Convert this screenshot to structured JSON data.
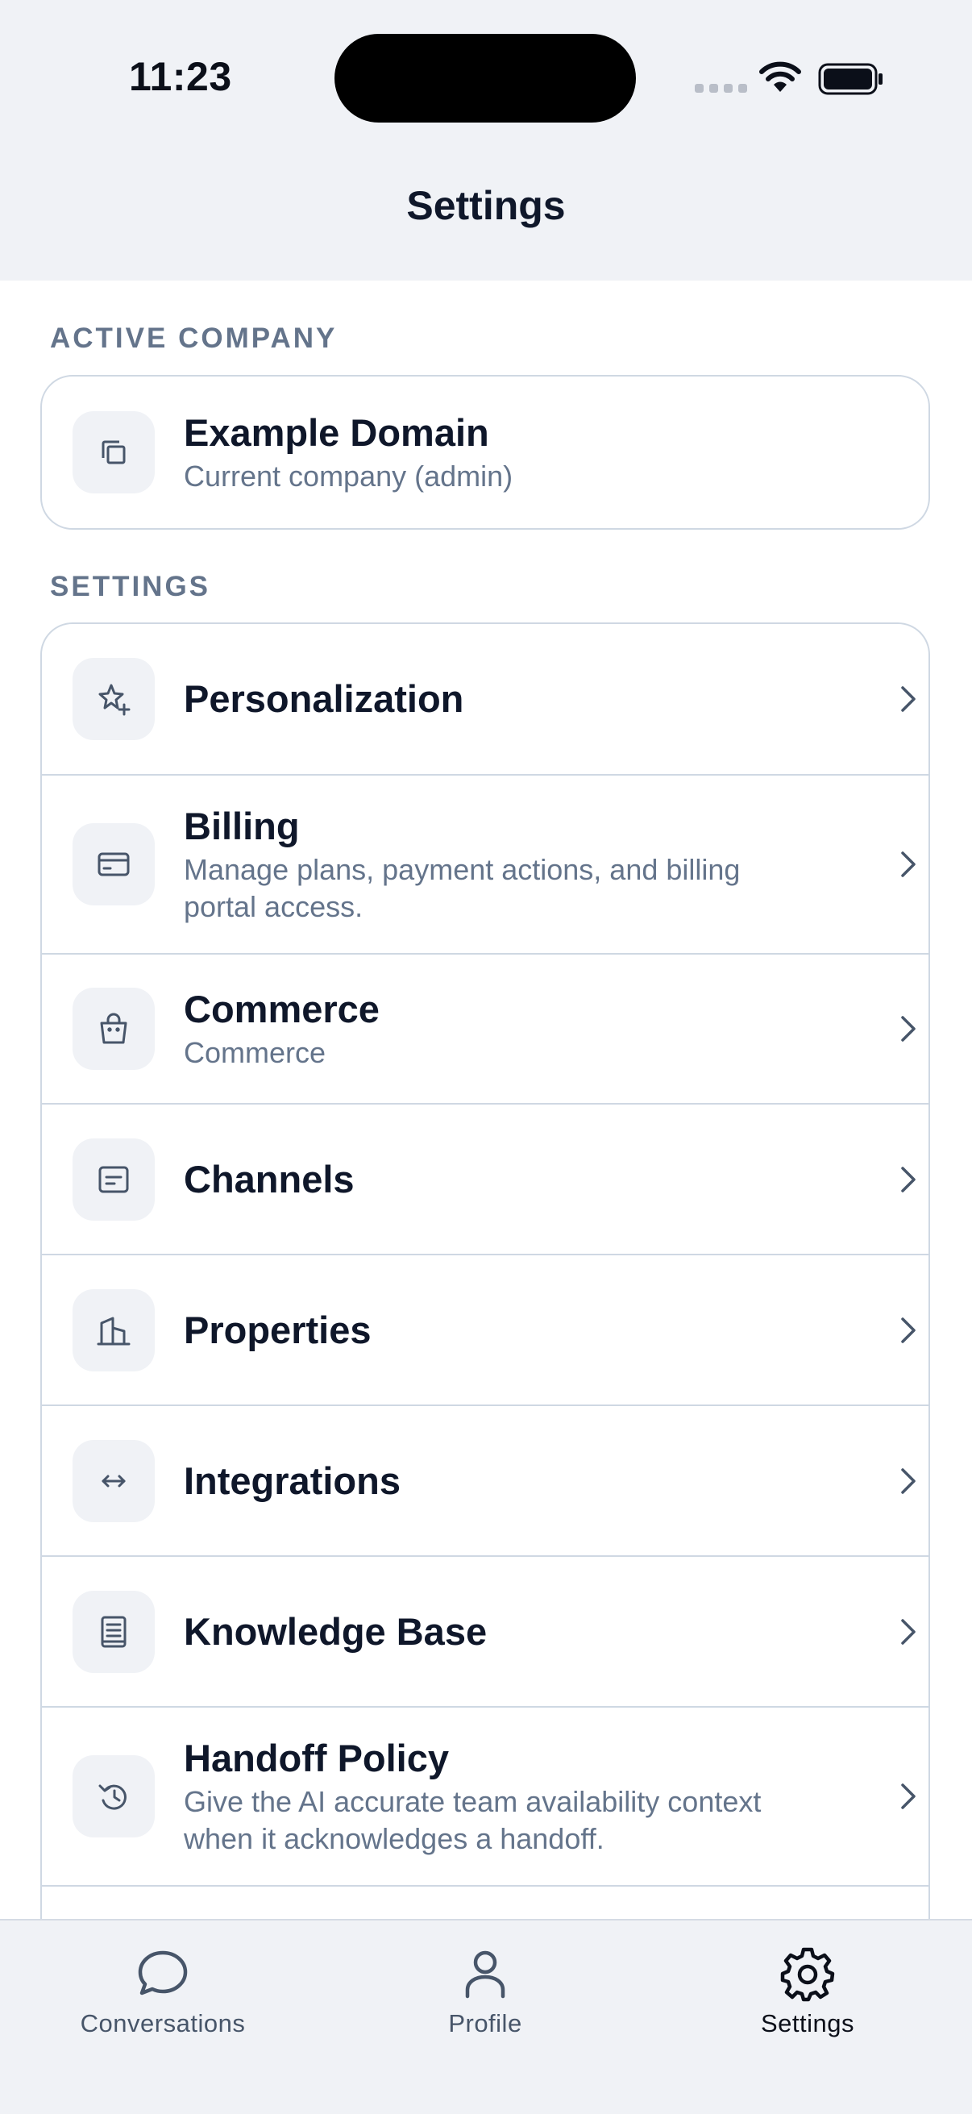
{
  "status_bar": {
    "time": "11:23"
  },
  "header": {
    "title": "Settings"
  },
  "active_company": {
    "section_label": "ACTIVE COMPANY",
    "name": "Example Domain",
    "subtitle": "Current company (admin)",
    "icon": "copy-icon"
  },
  "settings": {
    "section_label": "SETTINGS",
    "items": [
      {
        "label": "Personalization",
        "subtitle": "",
        "icon": "sparkle-star-icon"
      },
      {
        "label": "Billing",
        "subtitle": "Manage plans, payment actions, and billing portal access.",
        "icon": "credit-card-icon"
      },
      {
        "label": "Commerce",
        "subtitle": "Commerce",
        "icon": "shopping-bag-icon"
      },
      {
        "label": "Channels",
        "subtitle": "",
        "icon": "message-square-icon"
      },
      {
        "label": "Properties",
        "subtitle": "",
        "icon": "buildings-icon"
      },
      {
        "label": "Integrations",
        "subtitle": "",
        "icon": "arrows-horizontal-icon"
      },
      {
        "label": "Knowledge Base",
        "subtitle": "",
        "icon": "document-icon"
      },
      {
        "label": "Handoff Policy",
        "subtitle": "Give the AI accurate team availability context when it acknowledges a handoff.",
        "icon": "clock-history-icon"
      }
    ]
  },
  "tabbar": {
    "tabs": [
      {
        "label": "Conversations",
        "icon": "chat-bubble-icon",
        "active": false
      },
      {
        "label": "Profile",
        "icon": "person-icon",
        "active": false
      },
      {
        "label": "Settings",
        "icon": "gear-icon",
        "active": true
      }
    ]
  },
  "colors": {
    "background": "#ffffff",
    "header_background": "#f0f2f6",
    "text_primary": "#0f172a",
    "text_secondary": "#64748b",
    "border": "#cfd8e3"
  }
}
